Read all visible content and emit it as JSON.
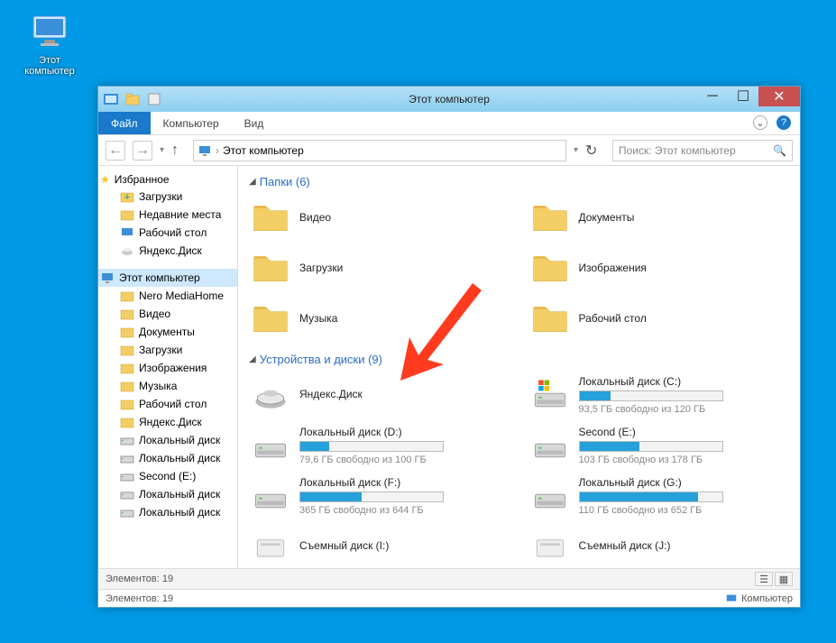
{
  "desktop_icon_label": "Этот компьютер",
  "window": {
    "title": "Этот компьютер",
    "ribbon": {
      "file": "Файл",
      "computer": "Компьютер",
      "view": "Вид"
    },
    "breadcrumb": "Этот компьютер",
    "search_placeholder": "Поиск: Этот компьютер"
  },
  "sidebar": {
    "favorites": "Избранное",
    "fav_items": [
      "Загрузки",
      "Недавние места",
      "Рабочий стол",
      "Яндекс.Диск"
    ],
    "this_pc": "Этот компьютер",
    "pc_items": [
      "Nero MediaHome",
      "Видео",
      "Документы",
      "Загрузки",
      "Изображения",
      "Музыка",
      "Рабочий стол",
      "Яндекс.Диск",
      "Локальный диск",
      "Локальный диск",
      "Second (E:)",
      "Локальный диск",
      "Локальный диск"
    ]
  },
  "sections": {
    "folders": "Папки (6)",
    "devices": "Устройства и диски (9)"
  },
  "folders": [
    {
      "name": "Видео"
    },
    {
      "name": "Документы"
    },
    {
      "name": "Загрузки"
    },
    {
      "name": "Изображения"
    },
    {
      "name": "Музыка"
    },
    {
      "name": "Рабочий стол"
    }
  ],
  "drives": [
    {
      "name": "Яндекс.Диск",
      "detail": "",
      "fill": 0
    },
    {
      "name": "Локальный диск (C:)",
      "detail": "93,5 ГБ свободно из 120 ГБ",
      "fill": 22,
      "windows": true
    },
    {
      "name": "Локальный диск (D:)",
      "detail": "79,6 ГБ свободно из 100 ГБ",
      "fill": 20
    },
    {
      "name": "Second (E:)",
      "detail": "103 ГБ свободно из 178 ГБ",
      "fill": 42
    },
    {
      "name": "Локальный диск (F:)",
      "detail": "365 ГБ свободно из 644 ГБ",
      "fill": 43
    },
    {
      "name": "Локальный диск (G:)",
      "detail": "110 ГБ свободно из 652 ГБ",
      "fill": 83
    },
    {
      "name": "Съемный диск (I:)",
      "detail": ""
    },
    {
      "name": "Съемный диск (J:)",
      "detail": ""
    }
  ],
  "status": {
    "elements": "Элементов: 19",
    "computer": "Компьютер"
  }
}
